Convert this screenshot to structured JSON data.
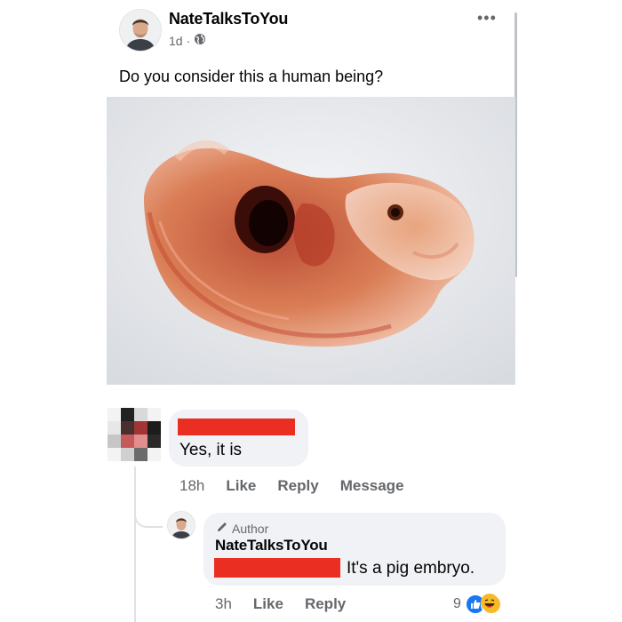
{
  "post": {
    "author": "NateTalksToYou",
    "time": "1d",
    "separator": "·",
    "visibility_icon": "globe-icon",
    "text": "Do you consider this a human being?",
    "more_icon": "ellipsis-icon",
    "more_symbol": "•••"
  },
  "comment": {
    "text": "Yes, it is",
    "actions": {
      "time": "18h",
      "like": "Like",
      "reply": "Reply",
      "message": "Message"
    }
  },
  "reply": {
    "badge": "Author",
    "badge_icon": "pencil-icon",
    "author": "NateTalksToYou",
    "text": "It's a pig embryo.",
    "actions": {
      "time": "3h",
      "like": "Like",
      "reply": "Reply"
    },
    "reaction_count": "9",
    "reaction_icons": [
      "like-icon",
      "haha-icon"
    ]
  },
  "colors": {
    "redaction": "#ea2e22",
    "bubble": "#f0f2f5",
    "secondary_text": "#65676b",
    "like_blue": "#1877f2"
  }
}
